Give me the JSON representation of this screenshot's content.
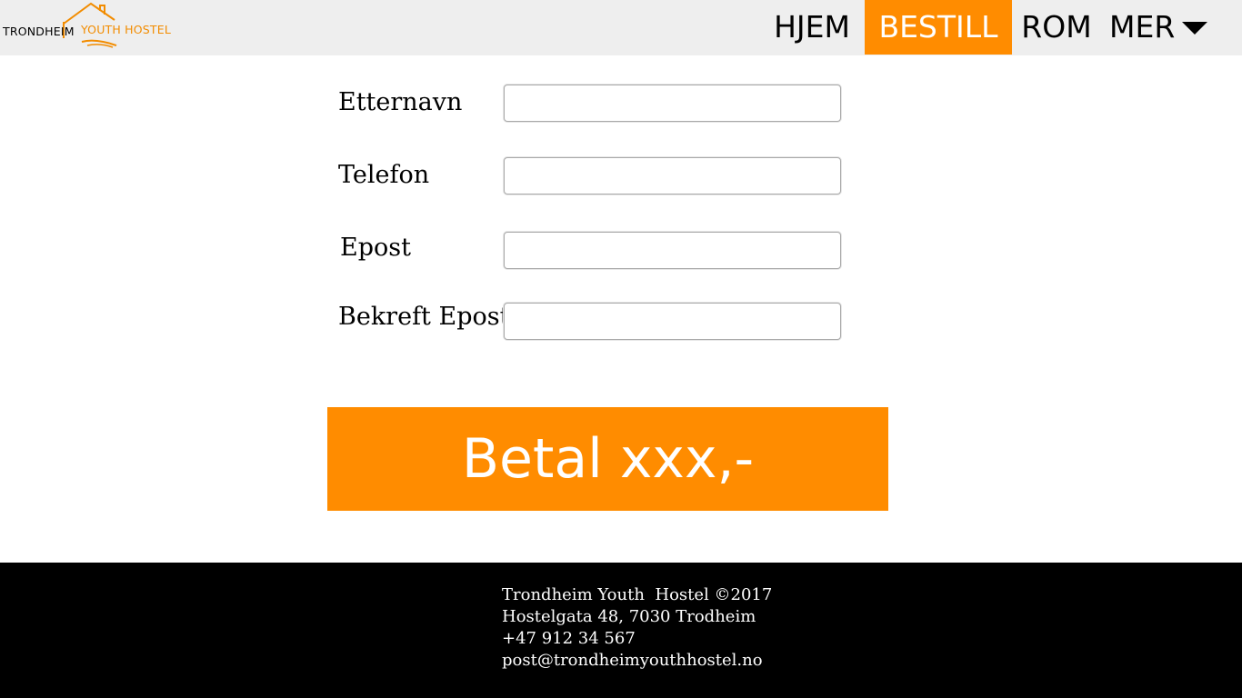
{
  "header": {
    "logo": {
      "text_part1": "TRONDHEIM",
      "text_part2": "YOUTH HOSTEL",
      "icon": "house-roof-logo"
    },
    "nav": [
      {
        "label": "HJEM",
        "active": false
      },
      {
        "label": "BESTILL",
        "active": true
      },
      {
        "label": "ROM",
        "active": false
      },
      {
        "label": "MER",
        "active": false,
        "icon": "caret-down-icon"
      }
    ]
  },
  "form": {
    "fields": [
      {
        "label": "Etternavn",
        "value": "",
        "placeholder": ""
      },
      {
        "label": "Telefon",
        "value": "",
        "placeholder": ""
      },
      {
        "label": "Epost",
        "value": "",
        "placeholder": ""
      },
      {
        "label": "Bekreft Epost",
        "value": "",
        "placeholder": ""
      }
    ],
    "submit_label": "Betal xxx,-"
  },
  "footer": {
    "lines": [
      "Trondheim Youth  Hostel ©2017",
      "Hostelgata 48, 7030 Trodheim",
      "+47 912 34 567",
      "post@trondheimyouthhostel.no"
    ]
  },
  "colors": {
    "accent": "#ff8c00",
    "header_bg": "#eeeeee",
    "footer_bg": "#000000"
  }
}
